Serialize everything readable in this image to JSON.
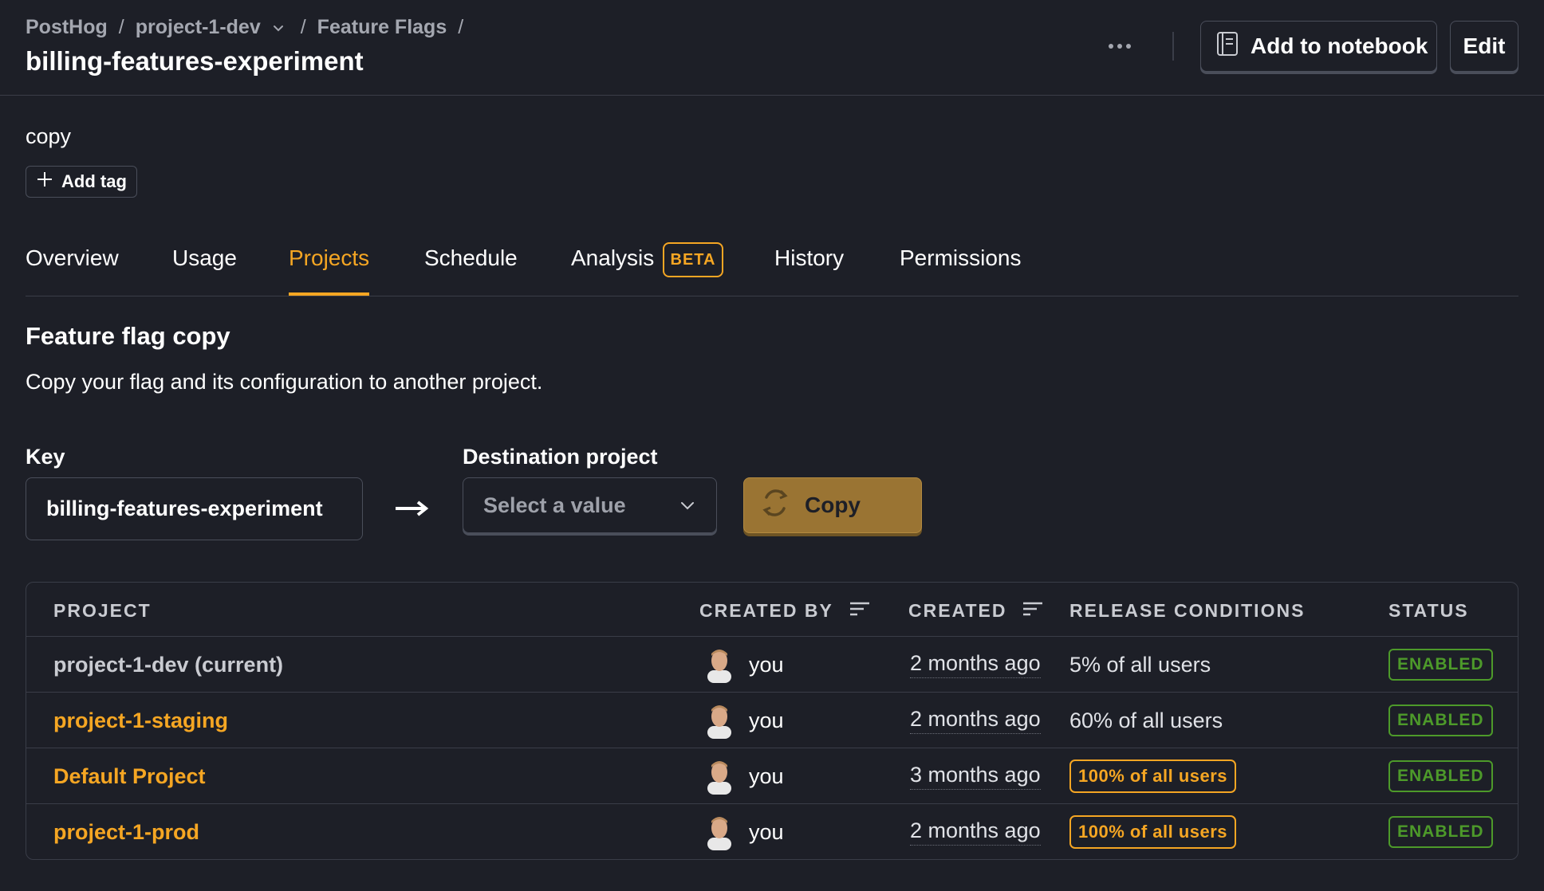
{
  "breadcrumb": {
    "items": [
      "PostHog",
      "project-1-dev",
      "Feature Flags"
    ],
    "separator": "/"
  },
  "page_title": "billing-features-experiment",
  "header_actions": {
    "more_icon": "ellipsis-icon",
    "notebook_label": "Add to notebook",
    "edit_label": "Edit"
  },
  "description": "copy",
  "add_tag_label": "Add tag",
  "tabs": [
    {
      "label": "Overview",
      "active": false
    },
    {
      "label": "Usage",
      "active": false
    },
    {
      "label": "Projects",
      "active": true
    },
    {
      "label": "Schedule",
      "active": false
    },
    {
      "label": "Analysis",
      "active": false,
      "badge": "BETA"
    },
    {
      "label": "History",
      "active": false
    },
    {
      "label": "Permissions",
      "active": false
    }
  ],
  "section": {
    "title": "Feature flag copy",
    "description": "Copy your flag and its configuration to another project."
  },
  "form": {
    "key_label": "Key",
    "key_value": "billing-features-experiment",
    "destination_label": "Destination project",
    "destination_placeholder": "Select a value",
    "copy_label": "Copy"
  },
  "table": {
    "headers": {
      "project": "PROJECT",
      "created_by": "CREATED BY",
      "created": "CREATED",
      "release_conditions": "RELEASE CONDITIONS",
      "status": "STATUS"
    },
    "rows": [
      {
        "project": "project-1-dev (current)",
        "created_by": "you",
        "created": "2 months ago",
        "release_conditions": "5% of all users",
        "status": "ENABLED"
      },
      {
        "project": "project-1-staging",
        "created_by": "you",
        "created": "2 months ago",
        "release_conditions": "60% of all users",
        "status": "ENABLED"
      },
      {
        "project": "Default Project",
        "created_by": "you",
        "created": "3 months ago",
        "release_conditions": "100% of all users",
        "status": "ENABLED"
      },
      {
        "project": "project-1-prod",
        "created_by": "you",
        "created": "2 months ago",
        "release_conditions": "100% of all users",
        "status": "ENABLED"
      }
    ]
  },
  "colors": {
    "background": "#1d1f27",
    "accent": "#f5a623",
    "enabled": "#4d9a2a",
    "copy_button": "#9a7433"
  }
}
